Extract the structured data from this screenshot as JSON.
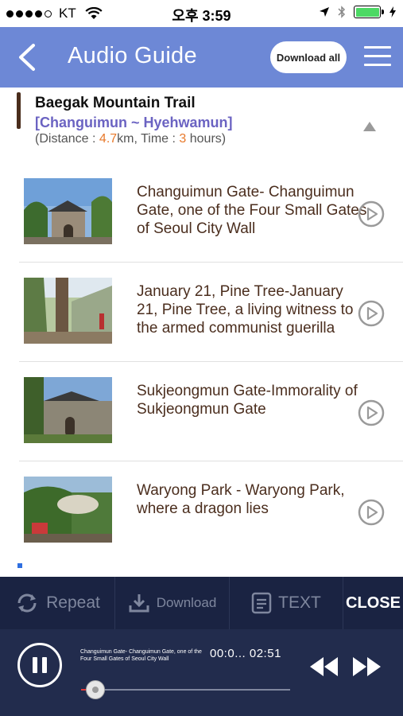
{
  "status_bar": {
    "carrier": "KT",
    "time": "오후 3:59",
    "signal_bars": 4
  },
  "header": {
    "title": "Audio Guide",
    "download_all_label": "Download all",
    "background_color": "#6d88d6"
  },
  "course": {
    "name": "Baegak Mountain Trail",
    "range": "[Changuimun ~ Hyehwamun]",
    "meta_prefix": "(Distance : ",
    "distance": "4.7",
    "distance_unit": "km, Time : ",
    "time": "3",
    "time_unit": " hours)"
  },
  "items": [
    {
      "label": "Changuimun Gate- Changuimun Gate, one of the Four Small Gates of  Seoul City Wall",
      "thumb": "gate-photo"
    },
    {
      "label": "January 21, Pine Tree-January 21, Pine Tree, a living witness to the armed communist guerilla",
      "thumb": "pine-tree-photo"
    },
    {
      "label": "Sukjeongmun Gate-Immorality of Sukjeongmun Gate",
      "thumb": "gate-wall-photo"
    },
    {
      "label": "Waryong Park - Waryong Park, where a dragon lies",
      "thumb": "park-sign-photo"
    }
  ],
  "controls": {
    "repeat_label": "Repeat",
    "download_label": "Download",
    "text_label": "TEXT",
    "close_label": "CLOSE"
  },
  "player": {
    "now_playing": "Changuimun Gate- Changuimun Gate, one of the Four Small Gates of  Seoul City Wall",
    "elapsed": "00:0...",
    "duration": "02:51",
    "progress_fraction": 0.07
  }
}
